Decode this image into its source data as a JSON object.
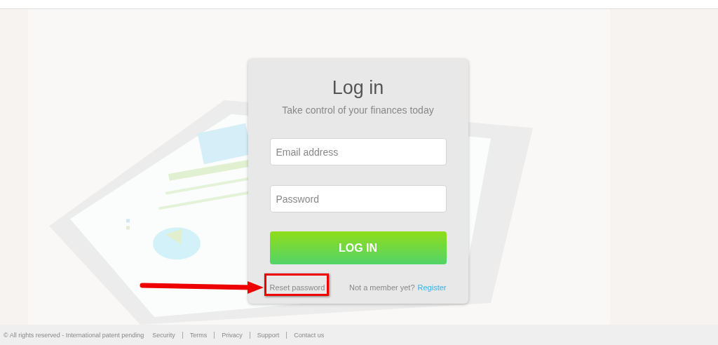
{
  "login": {
    "title": "Log in",
    "subtitle": "Take control of your finances today",
    "fields": [
      {
        "placeholder": "Email address"
      },
      {
        "placeholder": "Password"
      }
    ],
    "button": "LOG IN",
    "reset_link": "Reset password",
    "member_prompt": "Not a member yet?",
    "register_link": "Register"
  },
  "footer": {
    "copyright": "© All rights reserved - International patent pending",
    "links": [
      "Security",
      "Terms",
      "Privacy",
      "Support",
      "Contact us"
    ]
  }
}
